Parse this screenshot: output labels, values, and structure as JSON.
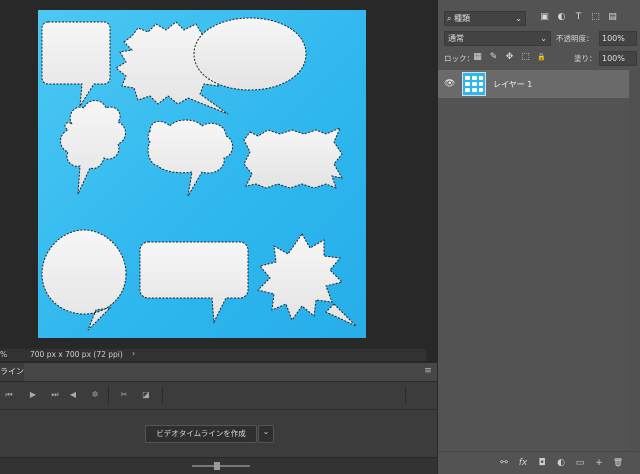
{
  "status": {
    "zoom": "%",
    "dimensions": "700 px x 700 px (72 ppi)",
    "arrow": "›"
  },
  "timeline": {
    "tab_label": "ライン",
    "menu_icon": "≡",
    "controls": [
      "⏮",
      "▶",
      "⏭",
      "◀",
      "✲",
      "✂",
      "◪"
    ],
    "create_button": "ビデオタイムラインを作成",
    "create_dropdown": "⌄"
  },
  "layers_panel": {
    "filter_kind": "種類",
    "blend_mode": "通常",
    "opacity_label": "不透明度：",
    "opacity_value": "100%",
    "lock_label": "ロック：",
    "fill_label": "塗り：",
    "fill_value": "100%",
    "layer_name": "レイヤー 1",
    "filter_icons": [
      "▣",
      "◐",
      "T",
      "⬚",
      "▤"
    ],
    "lock_icons": [
      "▦",
      "✎",
      "✥",
      "⬚",
      "🔒"
    ],
    "footer_icons": [
      "⚯",
      "fx",
      "◘",
      "◐",
      "▭",
      "+",
      "🗑"
    ]
  },
  "colors": {
    "canvas_bg": "#2eb6ee",
    "panel_bg": "#535353",
    "layer_selected": "#6a6a6a"
  }
}
